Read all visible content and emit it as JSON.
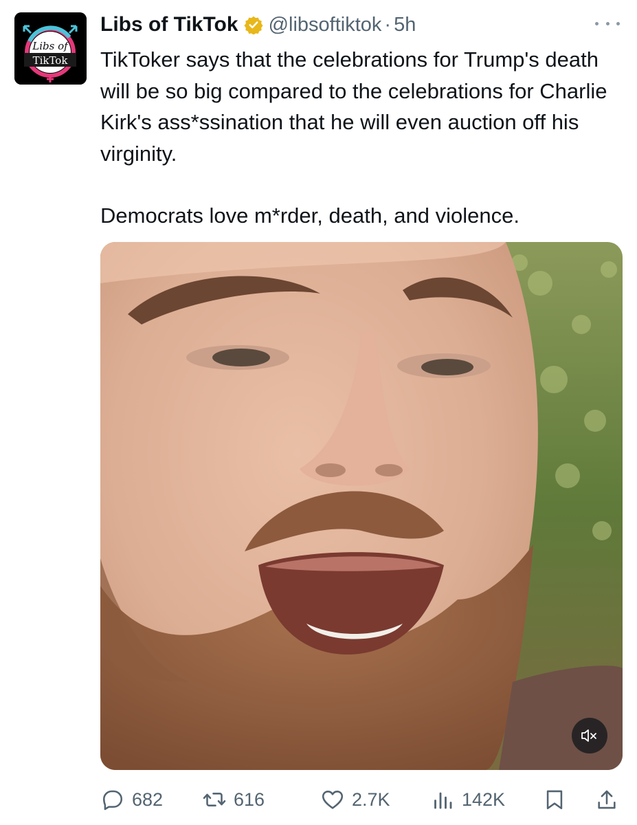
{
  "post": {
    "author": {
      "display_name": "Libs of TikTok",
      "handle": "@libsoftiktok",
      "separator": "·",
      "time": "5h",
      "avatar_text_line1": "Libs of",
      "avatar_text_line2": "TikTok",
      "verified_color": "#e8b71a"
    },
    "text": {
      "paragraph1": "TikToker says that the celebrations for Trump's death will be so big compared to the celebrations for Charlie Kirk's ass*ssination that he will even auction off his virginity.",
      "paragraph2": "Democrats love m*rder, death, and violence."
    },
    "media": {
      "type": "video",
      "muted": true,
      "mute_icon": "speaker-muted-icon"
    },
    "actions": {
      "replies": "682",
      "reposts": "616",
      "likes": "2.7K",
      "views": "142K"
    }
  },
  "colors": {
    "text_primary": "#0f1419",
    "text_secondary": "#536471",
    "avatar_blue": "#4cc3d9",
    "avatar_pink": "#e4387a"
  }
}
